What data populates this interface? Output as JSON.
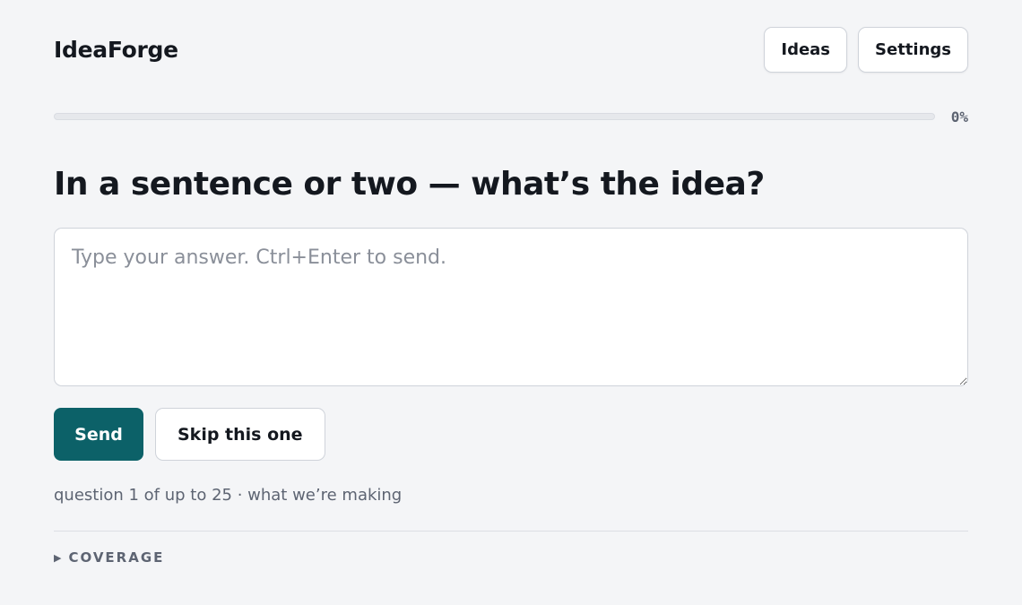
{
  "app": {
    "title": "IdeaForge"
  },
  "header": {
    "nav": [
      {
        "label": "Ideas"
      },
      {
        "label": "Settings"
      }
    ]
  },
  "progress": {
    "value": 0,
    "label": "0%"
  },
  "question": {
    "text": "In a sentence or two — what’s the idea?"
  },
  "answer": {
    "value": "",
    "placeholder": "Type your answer. Ctrl+Enter to send."
  },
  "actions": {
    "send_label": "Send",
    "skip_label": "Skip this one"
  },
  "meta": {
    "text": "question 1 of up to 25 · what we’re making"
  },
  "coverage": {
    "label": "COVERAGE",
    "icon": "caret-right-icon"
  },
  "colors": {
    "accent": "#0c6168",
    "background": "#f4f5f7",
    "muted_text": "#5d6472"
  }
}
